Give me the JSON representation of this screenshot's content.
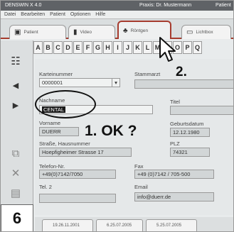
{
  "window": {
    "app_title": "DENSWIN X 4.0",
    "center_title": "Praxis: Dr. Mustermann",
    "right_title": "Patient"
  },
  "menu": [
    "Datei",
    "Bearbeiten",
    "Patient",
    "Optionen",
    "Hilfe"
  ],
  "tabs": [
    "Patient",
    "Video",
    "Röntgen",
    "Lichtbox"
  ],
  "alphabet": [
    "A",
    "B",
    "C",
    "D",
    "E",
    "F",
    "G",
    "H",
    "I",
    "J",
    "K",
    "L",
    "M",
    "N",
    "O",
    "P",
    "Q"
  ],
  "form": {
    "karteinummer": {
      "label": "Karteinummer",
      "value": "0000001"
    },
    "stammarzt": {
      "label": "Stammarzt",
      "value": ""
    },
    "nachname": {
      "label": "Nachname",
      "value": "CENTAL"
    },
    "titel": {
      "label": "Titel",
      "value": ""
    },
    "vorname": {
      "label": "Vorname",
      "value": "DUERR"
    },
    "geburtsdatum": {
      "label": "Geburtsdatum",
      "value": "12.12.1980"
    },
    "strasse": {
      "label": "Straße, Hausnummer",
      "value": "Hoepfigheimer Strasse 17"
    },
    "plz": {
      "label": "PLZ",
      "value": "74321"
    },
    "tel1": {
      "label": "Telefon-Nr.",
      "value": "+49(0)7142/7050"
    },
    "fax": {
      "label": "Fax",
      "value": "+49 (0)7142 / 705-500"
    },
    "tel2": {
      "label": "Tel. 2",
      "value": ""
    },
    "email": {
      "label": "Email",
      "value": "info@duerr.de"
    }
  },
  "annotations": {
    "step1": "1. OK ?",
    "step2": "2.",
    "step_number": "6"
  },
  "bottom_tabs": [
    "19.26.11.2001",
    "6.25.07.2005",
    "5.25.07.2005"
  ]
}
